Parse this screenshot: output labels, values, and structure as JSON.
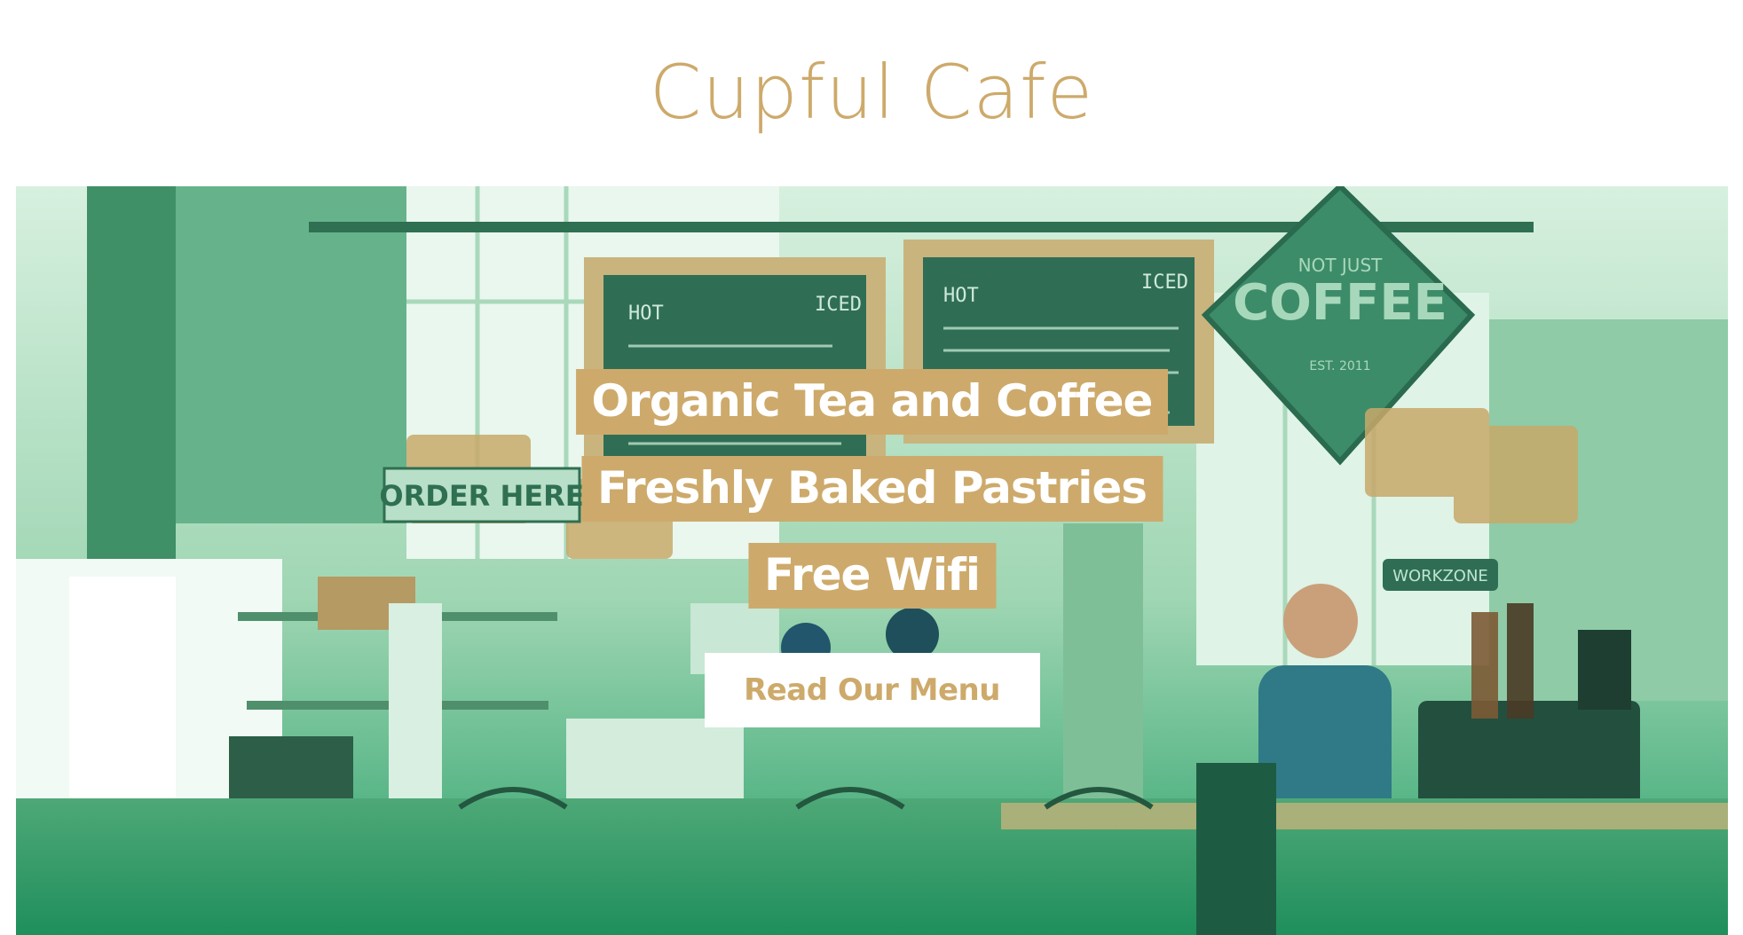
{
  "site": {
    "title": "Cupful Cafe"
  },
  "hero": {
    "taglines": [
      "Organic Tea and Coffee",
      "Freshly Baked Pastries",
      "Free Wifi"
    ],
    "cta_label": "Read Our Menu"
  },
  "scene_text": {
    "sign_top": "NOT JUST",
    "sign_main": "COFFEE",
    "sign_est": "EST. 2011",
    "order_here": "ORDER HERE",
    "board_left_hot": "HOT",
    "board_left_iced": "ICED",
    "board_right_hot": "HOT",
    "board_right_iced": "ICED",
    "work_zone": "WORKZONE"
  },
  "colors": {
    "accent": "#cdaa6b",
    "overlay_green": "#4bb07f",
    "background": "#ffffff"
  }
}
